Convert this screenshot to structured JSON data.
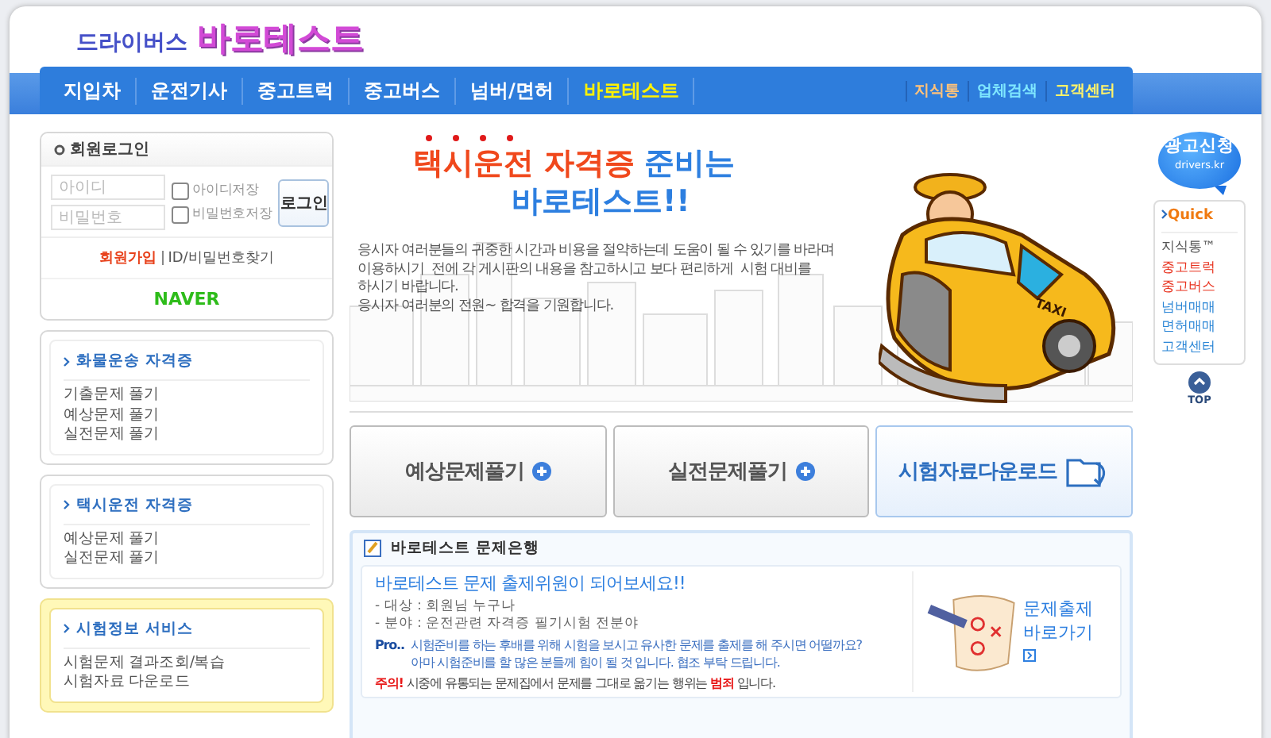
{
  "logo": {
    "small": "드라이버스",
    "big": "바로테스트"
  },
  "nav": [
    {
      "label": "지입차",
      "selected": false
    },
    {
      "label": "운전기사",
      "selected": false
    },
    {
      "label": "중고트럭",
      "selected": false
    },
    {
      "label": "중고버스",
      "selected": false
    },
    {
      "label": "넘버/면허",
      "selected": false
    },
    {
      "label": "바로테스트",
      "selected": true
    }
  ],
  "nav_links": [
    {
      "label": "지식통",
      "color": "#ffc27a"
    },
    {
      "label": "업체검색",
      "color": "#7fe7ff"
    },
    {
      "label": "고객센터",
      "color": "#fff36a"
    }
  ],
  "login": {
    "title": "회원로그인",
    "id_placeholder": "아이디",
    "pw_placeholder": "비밀번호",
    "save_id": {
      "label": "아이디저장",
      "checked": false
    },
    "save_pw": {
      "label": "비밀번호저장",
      "checked": false
    },
    "button": "로그인",
    "join": "회원가입",
    "find": "ID/비밀번호찾기",
    "naver": "NAVER"
  },
  "side_boxes": [
    {
      "kind": "plain",
      "title": "화물운송 자격증",
      "items": [
        "기출문제 풀기",
        "예상문제 풀기",
        "실전문제 풀기"
      ]
    },
    {
      "kind": "plain",
      "title": "택시운전 자격증",
      "items": [
        "예상문제 풀기",
        "실전문제 풀기"
      ]
    },
    {
      "kind": "highlight",
      "title": "시험정보 서비스",
      "items": [
        "시험문제 결과조회/복습",
        "시험자료 다운로드"
      ]
    }
  ],
  "banner": {
    "headline": [
      {
        "text": "택시운전 자격증",
        "color": "#f0481c"
      },
      {
        "text": "준비는",
        "color": "#2d7fe0"
      }
    ],
    "headline_line2": "바로테스트!!",
    "body": "응시자 여러분들의 귀중한 시간과 비용을 절약하는데 도움이 될 수 있기를 바라며\n이용하시기  전에 각 게시판의 내용을 참고하시고 보다 편리하게  시험 대비를\n하시기 바랍니다.\n응시자 여러분의 전원~ 합격을 기원합니다.",
    "taxi_sign": "TAXI"
  },
  "big_buttons": [
    {
      "label": "예상문제풀기",
      "kind": "plus",
      "selected": false
    },
    {
      "label": "실전문제풀기",
      "kind": "plus",
      "selected": false
    },
    {
      "label": "시험자료다운로드",
      "kind": "download",
      "selected": true
    }
  ],
  "bank": {
    "title": "바로테스트 문제은행",
    "heading": "바로테스트 문제 출제위원이 되어보세요!!",
    "details": [
      "- 대상 : 회원님 누구나",
      "- 분야 : 운전관련 자격증 필기시험 전분야"
    ],
    "pro_label": "Pro..",
    "pro_text": "시험준비를 하는 후배를 위해 시험을 보시고 유사한 문제를 출제를 해 주시면 어떨까요?\n아마 시험준비를 할 많은 분들께 힘이 될 것 입니다. 협조 부탁 드립니다.",
    "notice": "**주의!** 시중에 유통되는 문제집에서 문제를 그대로 옮기는 행위는 **범죄** 입니다.",
    "link_line1": "문제출제",
    "link_line2": "바로가기"
  },
  "ad": {
    "title": "광고신청",
    "sub": "drivers.kr"
  },
  "quick": {
    "title": "Quick",
    "items": [
      {
        "label": "지식통™",
        "color": "#555555"
      },
      {
        "label": "중고트럭",
        "color": "#e8321e"
      },
      {
        "label": "중고버스",
        "color": "#e8321e"
      },
      {
        "label": "넘버매매",
        "color": "#2b86d6"
      },
      {
        "label": "면허매매",
        "color": "#2b86d6"
      },
      {
        "label": "고객센터",
        "color": "#2b86d6"
      }
    ]
  },
  "top": "TOP"
}
